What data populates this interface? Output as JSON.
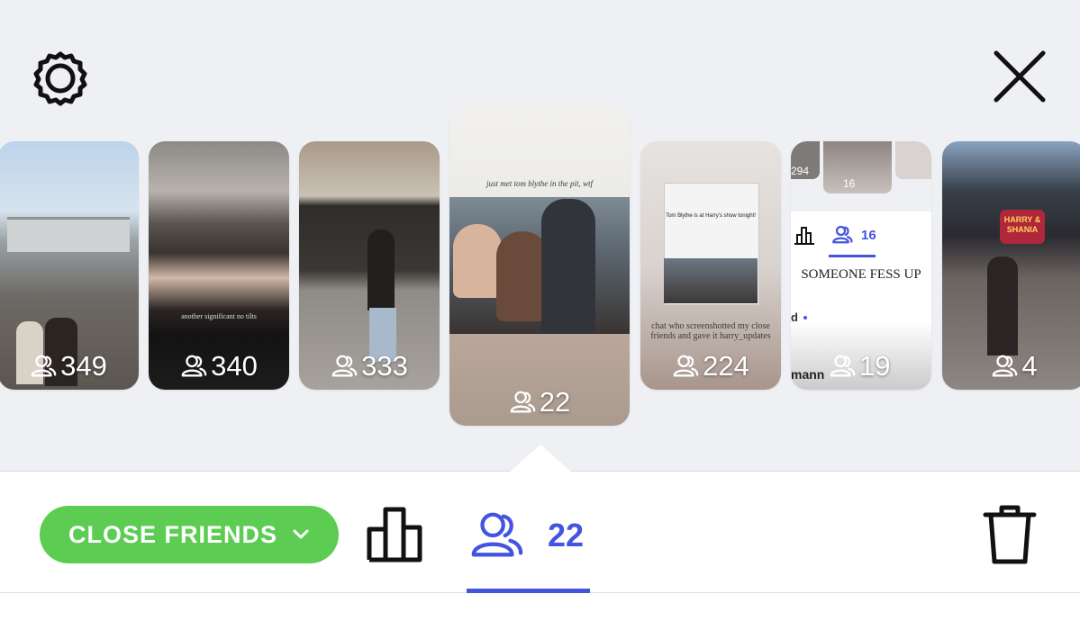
{
  "header": {
    "settings_icon": "gear-icon",
    "close_icon": "close-icon"
  },
  "stories": [
    {
      "viewers": "349"
    },
    {
      "viewers": "340",
      "caption": "another significant no tilts"
    },
    {
      "viewers": "333"
    },
    {
      "viewers": "22",
      "caption": "just met tom blythe in the pit, wtf"
    },
    {
      "viewers": "224",
      "inner_caption": "Tom Blythe is at Harry's show tonight!",
      "caption": "chat who screenshotted my close friends and gave it harry_updates"
    },
    {
      "viewers": "19",
      "tab_count": "16",
      "headline": "SOMEONE FESS UP",
      "peek_count": "294",
      "name_fragment": "mann",
      "d_fragment": "d"
    },
    {
      "viewers": "4",
      "sign": "HARRY & SHANIA"
    }
  ],
  "bottom_bar": {
    "audience_label": "CLOSE FRIENDS",
    "viewers_count": "22",
    "colors": {
      "accent": "#4354e0",
      "green": "#5ccc53"
    }
  }
}
